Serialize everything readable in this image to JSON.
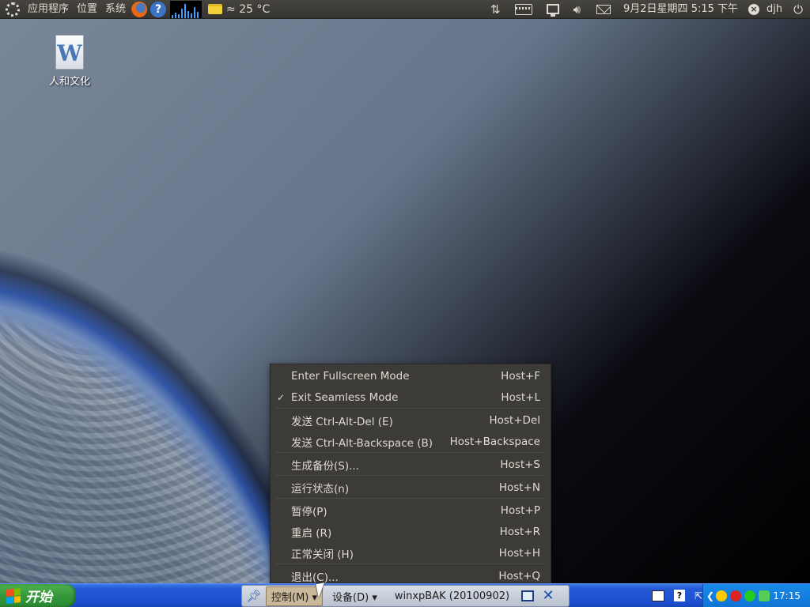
{
  "top_panel": {
    "menus": [
      "应用程序",
      "位置",
      "系统"
    ],
    "weather": "≈ 25 °C",
    "datetime": "9月2日星期四  5:15 下午",
    "user": "djh"
  },
  "desktop": {
    "icon_label": "人和文化",
    "icon_glyph": "W"
  },
  "menu": {
    "items": [
      {
        "label": "Enter Fullscreen Mode",
        "shortcut": "Host+F",
        "checked": false
      },
      {
        "label": "Exit Seamless Mode",
        "shortcut": "Host+L",
        "checked": true
      },
      {
        "label": "发送 Ctrl-Alt-Del (E)",
        "shortcut": "Host+Del",
        "checked": false
      },
      {
        "label": "发送 Ctrl-Alt-Backspace (B)",
        "shortcut": "Host+Backspace",
        "checked": false
      },
      {
        "label": "生成备份(S)...",
        "shortcut": "Host+S",
        "checked": false
      },
      {
        "label": "运行状态(n)",
        "shortcut": "Host+N",
        "checked": false
      },
      {
        "label": "暂停(P)",
        "shortcut": "Host+P",
        "checked": false
      },
      {
        "label": "重启 (R)",
        "shortcut": "Host+R",
        "checked": false
      },
      {
        "label": "正常关闭 (H)",
        "shortcut": "Host+H",
        "checked": false
      },
      {
        "label": "退出(C)...",
        "shortcut": "Host+Q",
        "checked": false
      }
    ],
    "check_glyph": "✓"
  },
  "taskbar": {
    "start_label": "开始",
    "control_menu": "控制(M) ▾",
    "device_menu": "设备(D) ▾",
    "vm_name": "winxpBAK (20100902)",
    "clock": "17:15"
  }
}
